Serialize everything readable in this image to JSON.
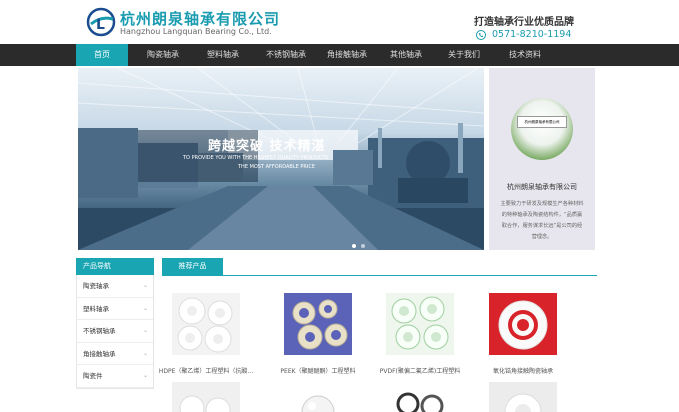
{
  "header": {
    "company_name": "杭州朗泉轴承有限公司",
    "company_en": "Hangzhou Langquan Bearing Co., Ltd.",
    "slogan": "打造轴承行业优质品牌",
    "phone": "0571-8210-1194",
    "logo_letter": "L"
  },
  "nav": {
    "items": [
      "首页",
      "陶瓷轴承",
      "塑料轴承",
      "不锈钢轴承",
      "角接触轴承",
      "其他轴承",
      "关于我们",
      "技术资料"
    ],
    "active_index": 0
  },
  "banner": {
    "title": "跨越突破  技术精湛",
    "subtitle_line1": "TO PROVIDE YOU WITH THE HIGHEST QUALITY PRODUCTS",
    "subtitle_line2": "THE MOST AFFORDABLE PRICE",
    "slide_count": 2,
    "active_slide": 1
  },
  "about_card": {
    "plate_text": "杭州朗泉轴承有限公司",
    "title": "杭州朗泉轴承有限公司",
    "description": "主要致力于研发及规模生产各种材料的特种轴承及陶瓷结构件，“品质赢取合作，服务谋求长远”是公司的经营理念。"
  },
  "product_nav": {
    "header": "产品导航",
    "items": [
      "陶瓷轴承",
      "塑料轴承",
      "不锈钢轴承",
      "角接触轴承",
      "陶瓷件"
    ]
  },
  "recommended": {
    "header": "推荐产品",
    "products": [
      {
        "caption": "HDPE（聚乙烯）工程塑料（抗酸...",
        "icon": "white-ball-bearings"
      },
      {
        "caption": "PEEK（聚醚醚酮）工程塑料",
        "icon": "peek-bearings"
      },
      {
        "caption": "PVDF(聚偏二氟乙烯)工程塑料",
        "icon": "pvdf-bearings"
      },
      {
        "caption": "氧化锆角接触陶瓷轴承",
        "icon": "zirconia-bearing"
      }
    ]
  },
  "colors": {
    "accent": "#19a5b1",
    "nav_bg": "#2b2b2b",
    "side_bg": "#e7e6ee"
  }
}
